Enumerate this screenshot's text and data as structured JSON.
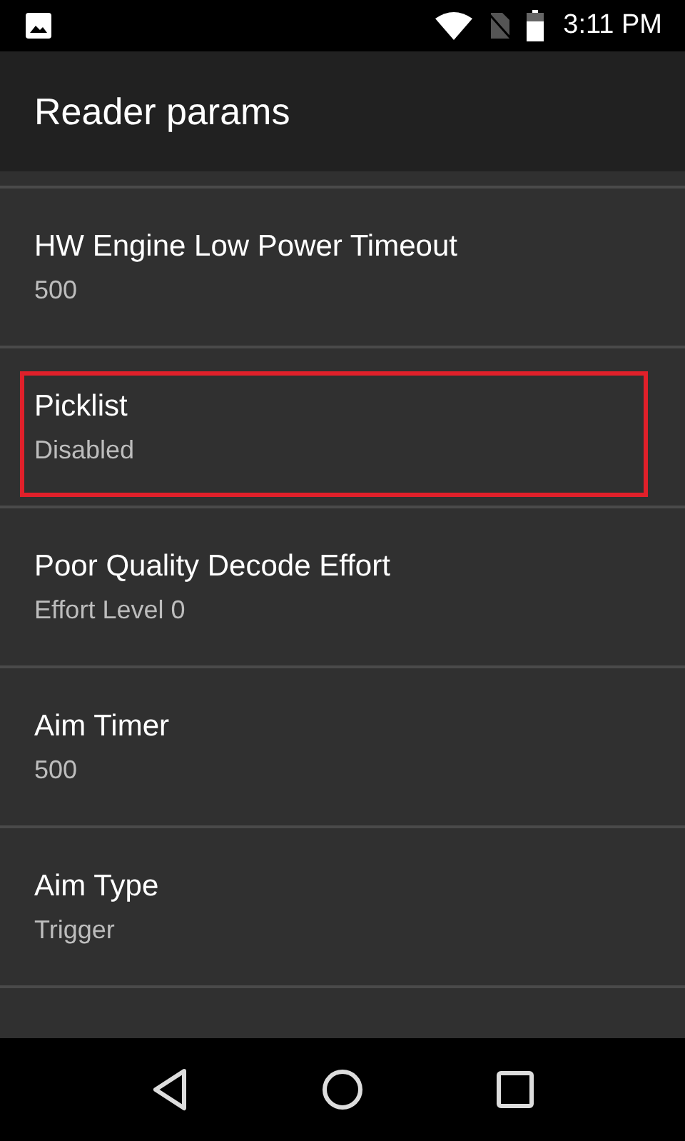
{
  "status_bar": {
    "time": "3:11 PM"
  },
  "app_bar": {
    "title": "Reader params"
  },
  "settings": [
    {
      "title": "HW Engine Low Power Timeout",
      "summary": "500",
      "highlighted": false
    },
    {
      "title": "Picklist",
      "summary": "Disabled",
      "highlighted": true
    },
    {
      "title": "Poor Quality Decode Effort",
      "summary": "Effort Level 0",
      "highlighted": false
    },
    {
      "title": "Aim Timer",
      "summary": "500",
      "highlighted": false
    },
    {
      "title": "Aim Type",
      "summary": "Trigger",
      "highlighted": false
    }
  ]
}
